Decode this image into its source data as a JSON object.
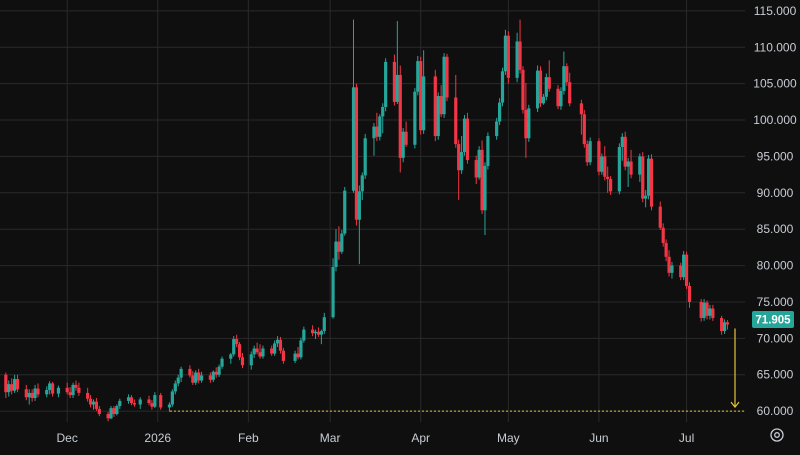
{
  "chart_data": {
    "type": "candlestick",
    "title": "",
    "xlabel": "",
    "ylabel": "",
    "ylim": [
      58.5,
      116.5
    ],
    "y_ticks": [
      "60.000",
      "65.000",
      "70.000",
      "75.000",
      "80.000",
      "85.000",
      "90.000",
      "95.000",
      "100.000",
      "105.000",
      "110.000",
      "115.000"
    ],
    "x_ticks": [
      {
        "label": "Dec",
        "date": "2025-12-01"
      },
      {
        "label": "2026",
        "date": "2026-01-01"
      },
      {
        "label": "Feb",
        "date": "2026-02-01"
      },
      {
        "label": "Mar",
        "date": "2026-03-01"
      },
      {
        "label": "Apr",
        "date": "2026-04-01"
      },
      {
        "label": "May",
        "date": "2026-05-01"
      },
      {
        "label": "Jun",
        "date": "2026-06-01"
      },
      {
        "label": "Jul",
        "date": "2026-07-01"
      }
    ],
    "last_price": "71.905",
    "target_level": 60.0,
    "grid": true,
    "colors": {
      "up": "#26a69a",
      "down": "#f23645",
      "grid": "#2a2a2a",
      "price_label": "#26a69a",
      "arrow": "#e7c53a",
      "target_line": "#e7c53a"
    },
    "candles": [
      [
        "2025-11-10",
        65.0,
        65.3,
        61.8,
        62.6
      ],
      [
        "2025-11-11",
        62.6,
        64.2,
        62.0,
        63.7
      ],
      [
        "2025-11-12",
        63.7,
        64.5,
        62.3,
        62.8
      ],
      [
        "2025-11-13",
        62.8,
        65.0,
        62.5,
        64.4
      ],
      [
        "2025-11-14",
        64.4,
        65.0,
        62.6,
        63.0
      ],
      [
        "2025-11-17",
        63.0,
        63.6,
        61.5,
        61.9
      ],
      [
        "2025-11-18",
        61.9,
        63.0,
        60.9,
        62.5
      ],
      [
        "2025-11-19",
        62.5,
        63.0,
        61.3,
        61.8
      ],
      [
        "2025-11-20",
        61.8,
        63.6,
        61.4,
        63.1
      ],
      [
        "2025-11-21",
        63.1,
        63.8,
        61.9,
        62.3
      ],
      [
        "2025-11-24",
        62.3,
        63.4,
        61.9,
        62.9
      ],
      [
        "2025-11-25",
        62.9,
        64.1,
        62.3,
        63.8
      ],
      [
        "2025-11-26",
        63.8,
        64.0,
        62.0,
        62.4
      ],
      [
        "2025-11-28",
        62.4,
        63.5,
        61.9,
        63.2
      ],
      [
        "2025-12-01",
        63.2,
        63.9,
        62.3,
        62.6
      ],
      [
        "2025-12-02",
        62.6,
        63.3,
        61.8,
        62.2
      ],
      [
        "2025-12-03",
        62.2,
        63.9,
        61.8,
        63.6
      ],
      [
        "2025-12-04",
        63.6,
        64.2,
        62.8,
        63.2
      ],
      [
        "2025-12-05",
        63.2,
        63.9,
        62.1,
        62.5
      ],
      [
        "2025-12-08",
        62.5,
        63.2,
        61.3,
        61.7
      ],
      [
        "2025-12-09",
        61.7,
        62.2,
        60.5,
        60.9
      ],
      [
        "2025-12-10",
        60.9,
        61.6,
        60.2,
        61.3
      ],
      [
        "2025-12-11",
        61.3,
        61.8,
        60.0,
        60.3
      ],
      [
        "2025-12-12",
        60.3,
        60.7,
        59.3,
        59.6
      ],
      [
        "2025-12-15",
        59.6,
        59.9,
        58.6,
        59.0
      ],
      [
        "2025-12-16",
        59.0,
        60.7,
        58.9,
        60.4
      ],
      [
        "2025-12-17",
        60.4,
        60.7,
        59.2,
        59.6
      ],
      [
        "2025-12-18",
        59.6,
        60.9,
        59.4,
        60.7
      ],
      [
        "2025-12-19",
        60.7,
        61.7,
        60.3,
        61.4
      ],
      [
        "2025-12-22",
        61.4,
        62.3,
        61.0,
        61.9
      ],
      [
        "2025-12-23",
        61.9,
        62.2,
        60.8,
        61.1
      ],
      [
        "2025-12-24",
        61.1,
        61.6,
        60.6,
        60.9
      ],
      [
        "2025-12-26",
        60.9,
        61.9,
        60.3,
        61.6
      ],
      [
        "2025-12-29",
        61.6,
        62.1,
        60.8,
        61.1
      ],
      [
        "2025-12-30",
        61.1,
        61.5,
        60.2,
        60.6
      ],
      [
        "2025-12-31",
        60.6,
        62.6,
        60.4,
        62.2
      ],
      [
        "2026-01-02",
        62.2,
        62.5,
        60.2,
        60.5
      ],
      [
        "2026-01-05",
        60.5,
        61.2,
        59.9,
        60.9
      ],
      [
        "2026-01-06",
        60.9,
        63.0,
        60.6,
        62.7
      ],
      [
        "2026-01-07",
        62.7,
        64.2,
        62.3,
        63.8
      ],
      [
        "2026-01-08",
        63.8,
        65.0,
        63.4,
        64.6
      ],
      [
        "2026-01-09",
        64.6,
        66.1,
        64.0,
        65.8
      ],
      [
        "2026-01-12",
        65.8,
        66.3,
        64.6,
        64.9
      ],
      [
        "2026-01-13",
        64.9,
        65.5,
        63.6,
        63.9
      ],
      [
        "2026-01-14",
        63.9,
        65.6,
        63.6,
        65.3
      ],
      [
        "2026-01-15",
        65.3,
        65.8,
        63.8,
        64.2
      ],
      [
        "2026-01-16",
        64.2,
        65.4,
        63.9,
        64.9
      ],
      [
        "2026-01-19",
        64.9,
        65.3,
        63.9,
        64.3
      ],
      [
        "2026-01-20",
        64.3,
        65.6,
        64.0,
        65.4
      ],
      [
        "2026-01-21",
        65.4,
        66.0,
        64.6,
        65.0
      ],
      [
        "2026-01-22",
        65.0,
        66.4,
        64.7,
        66.1
      ],
      [
        "2026-01-23",
        66.1,
        67.5,
        65.8,
        67.2
      ],
      [
        "2026-01-26",
        67.2,
        68.0,
        66.5,
        67.8
      ],
      [
        "2026-01-27",
        67.8,
        70.3,
        67.5,
        69.9
      ],
      [
        "2026-01-28",
        69.9,
        70.5,
        68.8,
        69.2
      ],
      [
        "2026-01-29",
        69.2,
        69.5,
        67.0,
        67.4
      ],
      [
        "2026-01-30",
        67.4,
        68.0,
        65.9,
        66.3
      ],
      [
        "2026-02-02",
        66.3,
        68.2,
        65.7,
        67.8
      ],
      [
        "2026-02-03",
        67.8,
        69.0,
        67.3,
        68.6
      ],
      [
        "2026-02-04",
        68.6,
        69.4,
        67.8,
        68.1
      ],
      [
        "2026-02-05",
        68.1,
        69.2,
        67.2,
        67.5
      ],
      [
        "2026-02-06",
        67.5,
        69.0,
        67.2,
        68.6
      ],
      [
        "2026-02-09",
        68.6,
        69.0,
        67.6,
        67.9
      ],
      [
        "2026-02-10",
        67.9,
        69.7,
        67.6,
        69.3
      ],
      [
        "2026-02-11",
        69.3,
        70.3,
        68.8,
        69.8
      ],
      [
        "2026-02-12",
        69.8,
        70.2,
        67.9,
        68.3
      ],
      [
        "2026-02-13",
        68.3,
        68.7,
        66.5,
        66.9
      ],
      [
        "2026-02-17",
        66.9,
        68.3,
        66.6,
        67.9
      ],
      [
        "2026-02-18",
        67.9,
        68.8,
        67.1,
        67.4
      ],
      [
        "2026-02-19",
        67.4,
        70.1,
        67.1,
        69.7
      ],
      [
        "2026-02-20",
        69.7,
        71.6,
        69.4,
        71.2
      ],
      [
        "2026-02-23",
        71.2,
        71.8,
        70.3,
        70.7
      ],
      [
        "2026-02-24",
        70.7,
        71.2,
        69.9,
        70.9
      ],
      [
        "2026-02-25",
        70.9,
        71.5,
        70.2,
        70.5
      ],
      [
        "2026-02-26",
        70.5,
        71.2,
        69.2,
        71.0
      ],
      [
        "2026-02-27",
        71.0,
        73.5,
        70.6,
        72.9
      ],
      [
        "2026-03-02",
        72.9,
        81.0,
        72.7,
        79.8
      ],
      [
        "2026-03-03",
        79.8,
        85.0,
        79.2,
        83.3
      ],
      [
        "2026-03-04",
        83.3,
        85.4,
        80.8,
        81.9
      ],
      [
        "2026-03-05",
        81.9,
        84.9,
        81.6,
        84.4
      ],
      [
        "2026-03-06",
        84.4,
        90.8,
        84.1,
        90.3
      ],
      [
        "2026-03-09",
        90.3,
        113.8,
        90.0,
        104.5
      ],
      [
        "2026-03-10",
        104.5,
        105.0,
        85.5,
        86.3
      ],
      [
        "2026-03-11",
        86.3,
        91.0,
        80.2,
        90.2
      ],
      [
        "2026-03-12",
        90.2,
        92.8,
        89.0,
        92.4
      ],
      [
        "2026-03-13",
        92.4,
        98.1,
        91.9,
        97.5
      ],
      [
        "2026-03-16",
        97.5,
        99.6,
        95.1,
        99.1
      ],
      [
        "2026-03-17",
        99.1,
        101.0,
        97.1,
        97.7
      ],
      [
        "2026-03-18",
        97.7,
        100.8,
        97.2,
        100.5
      ],
      [
        "2026-03-19",
        100.5,
        102.3,
        98.2,
        101.8
      ],
      [
        "2026-03-20",
        101.8,
        108.5,
        101.2,
        108.0
      ],
      [
        "2026-03-23",
        108.0,
        109.0,
        102.0,
        102.5
      ],
      [
        "2026-03-24",
        102.5,
        113.6,
        102.2,
        106.2
      ],
      [
        "2026-03-25",
        106.2,
        107.5,
        92.8,
        94.8
      ],
      [
        "2026-03-26",
        94.8,
        98.9,
        94.2,
        98.4
      ],
      [
        "2026-03-27",
        98.4,
        99.8,
        96.3,
        96.6
      ],
      [
        "2026-03-30",
        96.6,
        104.4,
        96.1,
        103.9
      ],
      [
        "2026-03-31",
        103.9,
        108.8,
        103.4,
        108.1
      ],
      [
        "2026-04-01",
        108.1,
        108.7,
        98.0,
        98.6
      ],
      [
        "2026-04-02",
        98.6,
        109.6,
        98.1,
        106.0
      ],
      [
        "2026-04-06",
        106.0,
        106.9,
        97.1,
        97.8
      ],
      [
        "2026-04-07",
        97.8,
        103.8,
        97.3,
        103.3
      ],
      [
        "2026-04-08",
        103.3,
        104.8,
        100.4,
        100.8
      ],
      [
        "2026-04-09",
        100.8,
        109.2,
        100.3,
        108.7
      ],
      [
        "2026-04-10",
        108.7,
        109.1,
        102.6,
        103.1
      ],
      [
        "2026-04-13",
        103.1,
        106.2,
        96.2,
        96.7
      ],
      [
        "2026-04-14",
        96.7,
        97.3,
        89.0,
        93.1
      ],
      [
        "2026-04-15",
        93.1,
        97.8,
        92.6,
        95.6
      ],
      [
        "2026-04-16",
        95.6,
        100.7,
        95.1,
        100.2
      ],
      [
        "2026-04-17",
        100.2,
        101.0,
        94.0,
        94.5
      ],
      [
        "2026-04-20",
        94.5,
        95.1,
        91.2,
        92.1
      ],
      [
        "2026-04-21",
        92.1,
        96.4,
        91.8,
        95.9
      ],
      [
        "2026-04-22",
        95.9,
        97.2,
        87.1,
        87.6
      ],
      [
        "2026-04-23",
        87.6,
        94.2,
        84.2,
        93.7
      ],
      [
        "2026-04-24",
        93.7,
        98.3,
        93.2,
        97.8
      ],
      [
        "2026-04-27",
        97.8,
        100.3,
        97.3,
        99.8
      ],
      [
        "2026-04-28",
        99.8,
        103.0,
        99.3,
        102.4
      ],
      [
        "2026-04-29",
        102.4,
        107.2,
        101.9,
        106.7
      ],
      [
        "2026-04-30",
        106.7,
        112.4,
        106.2,
        111.6
      ],
      [
        "2026-05-01",
        111.6,
        112.2,
        105.0,
        105.8
      ],
      [
        "2026-05-04",
        105.8,
        112.0,
        105.2,
        110.8
      ],
      [
        "2026-05-05",
        110.8,
        113.8,
        106.4,
        106.9
      ],
      [
        "2026-05-06",
        106.9,
        107.4,
        100.9,
        101.4
      ],
      [
        "2026-05-07",
        101.4,
        105.1,
        94.8,
        97.5
      ],
      [
        "2026-05-08",
        97.5,
        102.1,
        97.0,
        101.6
      ],
      [
        "2026-05-11",
        101.6,
        107.5,
        101.1,
        106.8
      ],
      [
        "2026-05-12",
        106.8,
        107.4,
        101.8,
        102.3
      ],
      [
        "2026-05-13",
        102.3,
        103.6,
        102.1,
        103.2
      ],
      [
        "2026-05-14",
        103.2,
        106.4,
        102.7,
        105.9
      ],
      [
        "2026-05-15",
        105.9,
        108.2,
        103.9,
        104.3
      ],
      [
        "2026-05-18",
        104.3,
        104.8,
        101.5,
        101.9
      ],
      [
        "2026-05-19",
        101.9,
        104.5,
        101.4,
        104.0
      ],
      [
        "2026-05-20",
        104.0,
        109.4,
        103.5,
        107.4
      ],
      [
        "2026-05-21",
        107.4,
        107.8,
        104.7,
        105.2
      ],
      [
        "2026-05-22",
        105.2,
        106.5,
        101.9,
        102.3
      ],
      [
        "2026-05-26",
        102.3,
        102.8,
        98.0,
        100.8
      ],
      [
        "2026-05-27",
        100.8,
        101.4,
        96.2,
        96.7
      ],
      [
        "2026-05-28",
        96.7,
        97.2,
        93.7,
        94.2
      ],
      [
        "2026-05-29",
        94.2,
        97.6,
        93.8,
        97.1
      ],
      [
        "2026-06-01",
        97.1,
        97.5,
        92.4,
        92.9
      ],
      [
        "2026-06-02",
        92.9,
        95.4,
        92.5,
        95.0
      ],
      [
        "2026-06-03",
        95.0,
        96.4,
        91.7,
        92.2
      ],
      [
        "2026-06-04",
        92.2,
        93.6,
        90.0,
        91.9
      ],
      [
        "2026-06-05",
        91.9,
        92.3,
        89.7,
        90.2
      ],
      [
        "2026-06-08",
        90.2,
        96.8,
        89.8,
        96.3
      ],
      [
        "2026-06-09",
        96.3,
        98.2,
        94.4,
        97.7
      ],
      [
        "2026-06-10",
        97.7,
        98.4,
        93.1,
        93.6
      ],
      [
        "2026-06-11",
        93.6,
        94.8,
        90.8,
        94.3
      ],
      [
        "2026-06-12",
        94.3,
        95.9,
        92.0,
        92.5
      ],
      [
        "2026-06-15",
        92.5,
        95.4,
        91.5,
        95.0
      ],
      [
        "2026-06-16",
        95.0,
        95.6,
        88.7,
        89.2
      ],
      [
        "2026-06-17",
        89.2,
        90.4,
        88.0,
        89.6
      ],
      [
        "2026-06-18",
        89.6,
        95.2,
        89.1,
        94.7
      ],
      [
        "2026-06-19",
        94.7,
        95.3,
        87.6,
        88.1
      ],
      [
        "2026-06-22",
        88.1,
        88.8,
        84.9,
        85.2
      ],
      [
        "2026-06-23",
        85.2,
        85.8,
        82.6,
        83.1
      ],
      [
        "2026-06-24",
        83.1,
        83.6,
        80.6,
        81.2
      ],
      [
        "2026-06-25",
        81.2,
        82.1,
        78.5,
        79.0
      ],
      [
        "2026-06-26",
        79.0,
        80.5,
        78.2,
        80.0
      ],
      [
        "2026-06-29",
        80.0,
        80.4,
        78.0,
        78.4
      ],
      [
        "2026-06-30",
        78.4,
        82.0,
        78.0,
        81.5
      ],
      [
        "2026-07-01",
        81.5,
        81.9,
        76.8,
        77.2
      ],
      [
        "2026-07-02",
        77.2,
        77.7,
        74.2,
        75.0
      ],
      [
        "2026-07-06",
        75.0,
        75.4,
        72.3,
        72.8
      ],
      [
        "2026-07-07",
        72.8,
        75.4,
        72.4,
        74.9
      ],
      [
        "2026-07-08",
        74.9,
        75.2,
        72.6,
        73.1
      ],
      [
        "2026-07-09",
        73.1,
        74.6,
        72.6,
        74.1
      ],
      [
        "2026-07-10",
        74.1,
        74.6,
        72.4,
        72.8
      ],
      [
        "2026-07-13",
        72.8,
        73.1,
        70.5,
        71.0
      ],
      [
        "2026-07-14",
        71.0,
        72.6,
        70.6,
        72.2
      ],
      [
        "2026-07-15",
        72.2,
        72.5,
        71.2,
        71.9
      ]
    ]
  },
  "ui": {
    "settings_icon": "gear-icon"
  }
}
